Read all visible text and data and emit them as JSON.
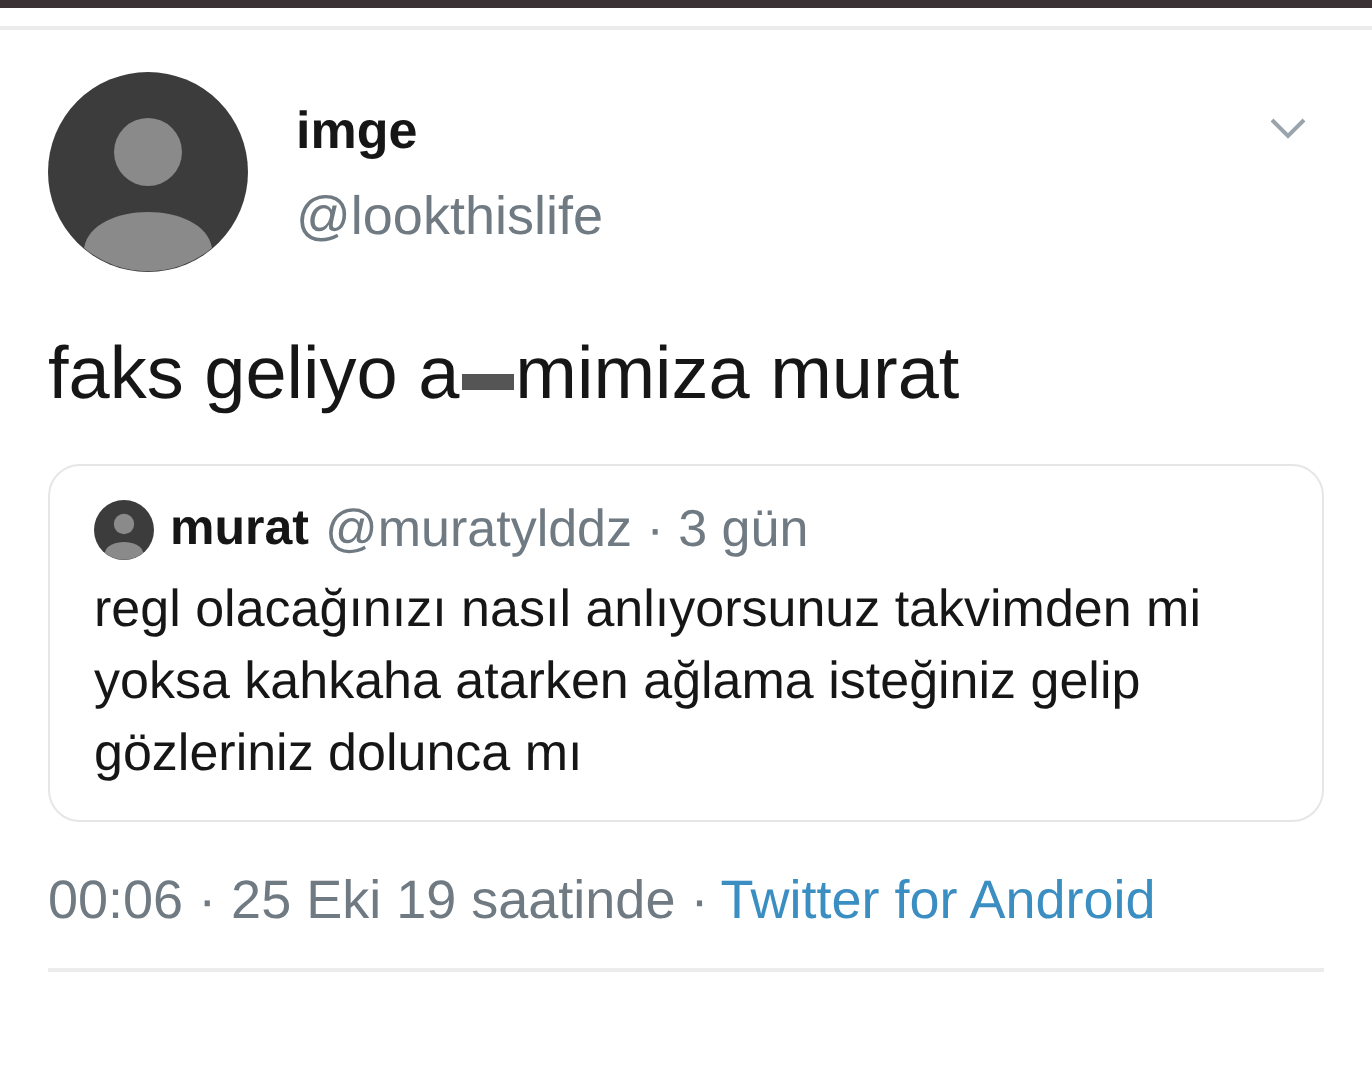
{
  "author": {
    "name": "imge",
    "handle": "@lookthislife"
  },
  "tweet": {
    "text_before": "faks geliyo a",
    "text_after": "mimiza murat"
  },
  "quoted": {
    "name": "murat",
    "meta": "@muratylddz · 3 gün",
    "text": "regl olacağınızı nasıl anlıyorsunuz takvimden mi yoksa kahkaha atarken ağlama isteğiniz gelip gözleriniz dolunca mı"
  },
  "footer": {
    "info": "00:06 · 25 Eki 19 saatinde ·",
    "source": "Twitter for Android"
  }
}
